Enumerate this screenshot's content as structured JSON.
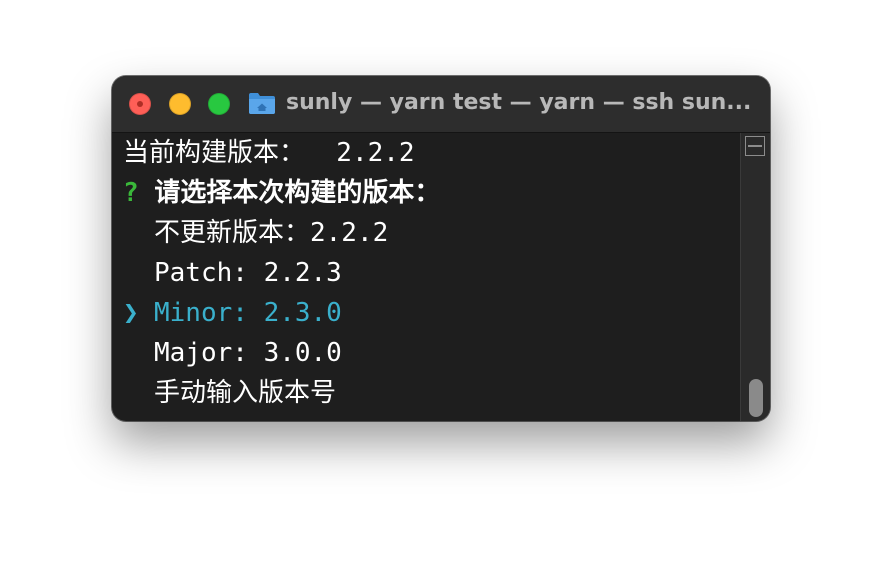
{
  "window": {
    "title": "sunly — yarn test — yarn — ssh sun...",
    "traffic_lights": [
      "close",
      "minimize",
      "zoom"
    ],
    "folder_icon": "home-folder-icon"
  },
  "terminal": {
    "line1": "当前构建版本：  2.2.2",
    "prompt_mark": "?",
    "prompt_question": "请选择本次构建的版本：",
    "options": [
      {
        "label": "不更新版本：2.2.2",
        "selected": false
      },
      {
        "label": "Patch: 2.2.3",
        "selected": false
      },
      {
        "label": "Minor: 2.3.0",
        "selected": true
      },
      {
        "label": "Major: 3.0.0",
        "selected": false
      },
      {
        "label": "手动输入版本号",
        "selected": false
      }
    ],
    "pointer": "❯"
  },
  "colors": {
    "background": "#1e1e1e",
    "text": "#ffffff",
    "prompt_mark": "#3ab83a",
    "selected": "#3ab0cc",
    "title_text": "#b8b8b8"
  }
}
